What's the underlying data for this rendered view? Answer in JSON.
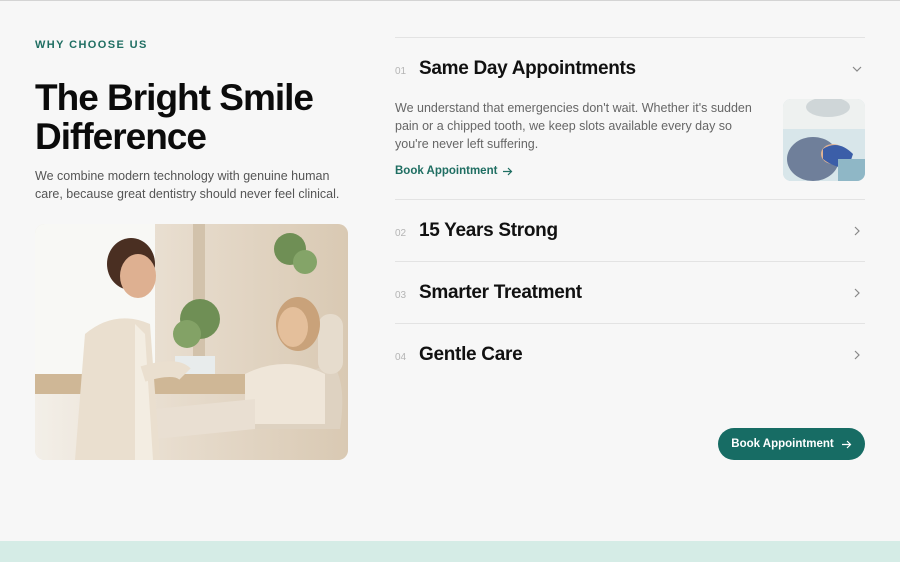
{
  "section": {
    "eyebrow": "WHY CHOOSE US",
    "headline": "The Bright Smile Difference",
    "lede": "We combine modern technology with genuine human care, because great dentistry should never feel clinical."
  },
  "accordion": {
    "items": [
      {
        "number": "01",
        "title": "Same Day Appointments",
        "expanded": true,
        "body": "We understand that emergencies don't wait. Whether it's sudden pain or a chipped tooth, we keep slots available every day so you're never left suffering.",
        "link_label": "Book Appointment"
      },
      {
        "number": "02",
        "title": "15 Years Strong",
        "expanded": false
      },
      {
        "number": "03",
        "title": "Smarter Treatment",
        "expanded": false
      },
      {
        "number": "04",
        "title": "Gentle Care",
        "expanded": false
      }
    ]
  },
  "cta": {
    "label": "Book Appointment"
  },
  "colors": {
    "accent": "#176c64",
    "eyebrow": "#1f6e62",
    "background": "#f7f7f7",
    "footer_band": "#d5ece6"
  },
  "icons": {
    "expanded_chevron": "chevron-down-icon",
    "collapsed_chevron": "chevron-right-icon",
    "link_arrow": "arrow-right-icon"
  }
}
